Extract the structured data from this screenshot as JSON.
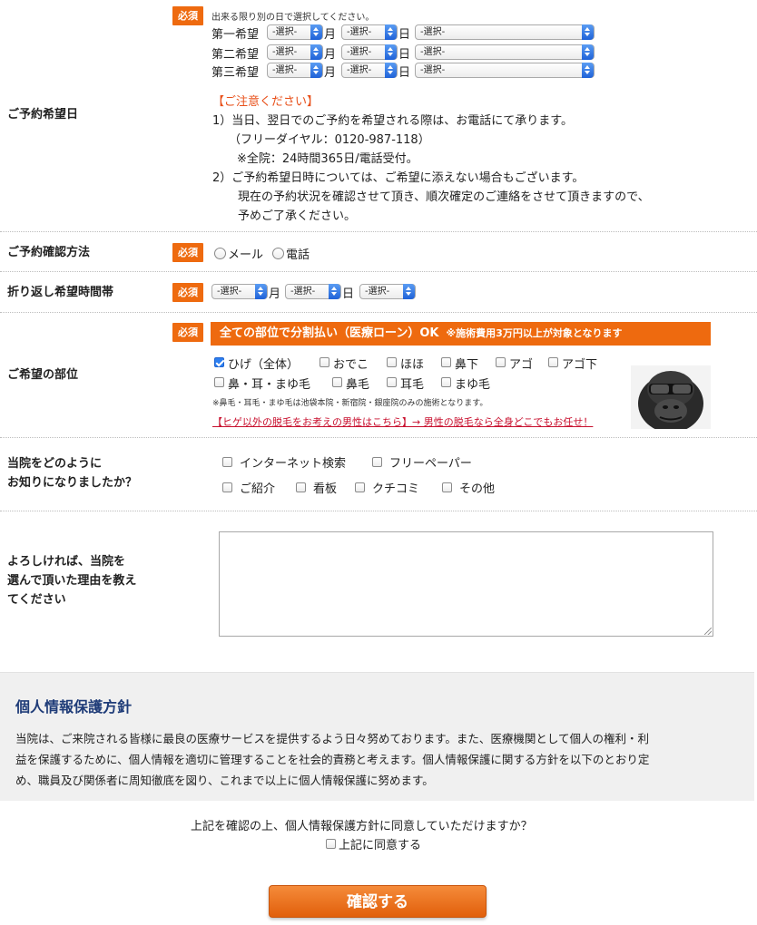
{
  "required_label": "必須",
  "select_placeholder": "-選択-",
  "date": {
    "label": "ご予約希望日",
    "instruction": "出来る限り別の日で選択してください。",
    "choices": [
      {
        "label": "第一希望"
      },
      {
        "label": "第二希望"
      },
      {
        "label": "第三希望"
      }
    ],
    "unit_month": "月",
    "unit_day": "日",
    "notice_title": "【ご注意ください】",
    "notice_lines": [
      "1）当日、翌日でのご予約を希望される際は、お電話にて承ります。",
      "（フリーダイヤル：0120-987-118）",
      "※全院：24時間365日/電話受付。",
      "2）ご予約希望日時については、ご希望に添えない場合もございます。",
      "現在の予約状況を確認させて頂き、順次確定のご連絡をさせて頂きますので、",
      "予めご了承ください。"
    ]
  },
  "confirm_method": {
    "label": "ご予約確認方法",
    "options": [
      "メール",
      "電話"
    ]
  },
  "callback": {
    "label": "折り返し希望時間帯",
    "unit_month": "月",
    "unit_day": "日"
  },
  "parts": {
    "label": "ご希望の部位",
    "banner_main": "全ての部位で分割払い（医療ローン）OK",
    "banner_sub": "※施術費用3万円以上が対象となります",
    "options": [
      {
        "label": "ひげ（全体）",
        "checked": true
      },
      {
        "label": "おでこ",
        "checked": false
      },
      {
        "label": "ほほ",
        "checked": false
      },
      {
        "label": "鼻下",
        "checked": false
      },
      {
        "label": "アゴ",
        "checked": false
      },
      {
        "label": "アゴ下",
        "checked": false
      },
      {
        "label": "鼻・耳・まゆ毛",
        "checked": false
      },
      {
        "label": "鼻毛",
        "checked": false
      },
      {
        "label": "耳毛",
        "checked": false
      },
      {
        "label": "まゆ毛",
        "checked": false
      }
    ],
    "note": "※鼻毛・耳毛・まゆ毛は池袋本院・新宿院・銀座院のみの施術となります。",
    "link": "【ヒゲ以外の脱毛をお考えの男性はこちら】→ 男性の脱毛なら全身どこでもお任せ！"
  },
  "source": {
    "label_line1": "当院をどのように",
    "label_line2": "お知りになりましたか？",
    "options": [
      "インターネット検索",
      "フリーペーパー",
      "ご紹介",
      "看板",
      "クチコミ",
      "その他"
    ]
  },
  "reason": {
    "label_lines": [
      "よろしければ、当院を",
      "選んで頂いた理由を教え",
      "てください"
    ]
  },
  "policy": {
    "title": "個人情報保護方針",
    "lines": [
      "当院は、ご来院される皆様に最良の医療サービスを提供するよう日々努めております。また、医療機関として個人の権利・利",
      "益を保護するために、個人情報を適切に管理することを社会的責務と考えます。個人情報保護に関する方針を以下のとおり定",
      "め、職員及び関係者に周知徹底を図り、これまで以上に個人情報保護に努めます。"
    ]
  },
  "agree": {
    "question": "上記を確認の上、個人情報保護方針に同意していただけますか？",
    "checkbox_label": "上記に同意する"
  },
  "submit_label": "確認する",
  "colors": {
    "accent": "#ee6a0f",
    "notice": "#e8501a",
    "link": "#c8102e",
    "policy_title": "#1f3c78"
  }
}
